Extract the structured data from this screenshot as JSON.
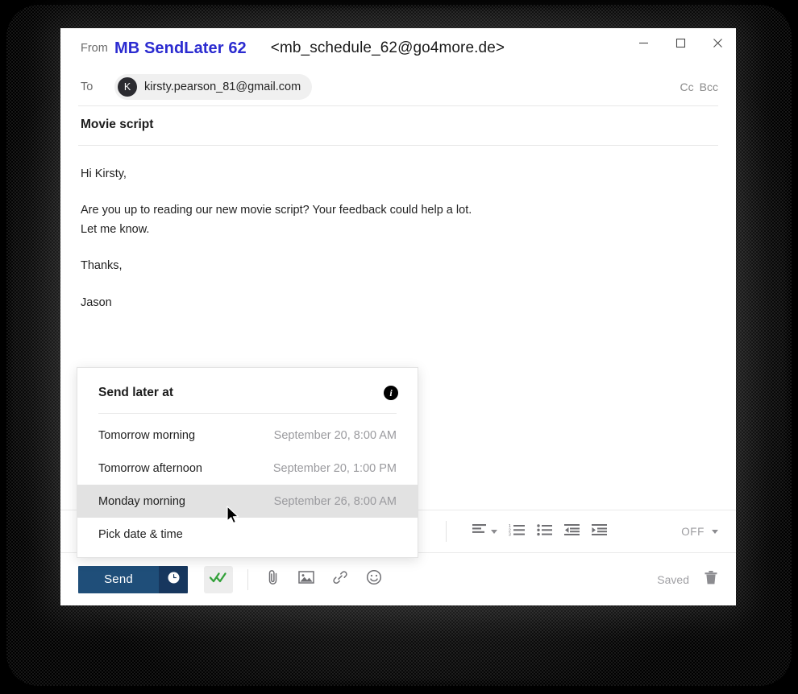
{
  "window": {
    "controls": [
      {
        "name": "minimize",
        "glyph": "—"
      },
      {
        "name": "maximize",
        "glyph": "□"
      },
      {
        "name": "close",
        "glyph": "✕"
      }
    ]
  },
  "compose": {
    "from_label": "From",
    "from_name": "MB SendLater 62",
    "from_address": "<mb_schedule_62@go4more.de>",
    "to_label": "To",
    "recipient_initial": "K",
    "recipient_email": "kirsty.pearson_81@gmail.com",
    "cc_label": "Cc",
    "bcc_label": "Bcc",
    "subject": "Movie script",
    "body": {
      "greeting": "Hi Kirsty,",
      "line1": "Are you up to reading our new movie script? Your feedback could help a lot.",
      "line2": "Let me know.",
      "closing": "Thanks,",
      "signature": "Jason"
    }
  },
  "send_later": {
    "title": "Send later at",
    "info_glyph": "i",
    "options": [
      {
        "label": "Tomorrow morning",
        "datetime": "September 20, 8:00 AM",
        "highlighted": false
      },
      {
        "label": "Tomorrow afternoon",
        "datetime": "September 20, 1:00 PM",
        "highlighted": false
      },
      {
        "label": "Monday morning",
        "datetime": "September 26, 8:00 AM",
        "highlighted": true
      },
      {
        "label": "Pick date & time",
        "datetime": "",
        "highlighted": false
      }
    ]
  },
  "format_toolbar": {
    "align_icon": "align-left-icon",
    "numbered_list_icon": "numbered-list-icon",
    "bullet_list_icon": "bullet-list-icon",
    "outdent_icon": "outdent-icon",
    "indent_icon": "indent-icon",
    "tracking_state": "OFF"
  },
  "bottom_bar": {
    "send_label": "Send",
    "schedule_icon": "clock-icon",
    "read_receipt_icon": "double-check-icon",
    "attach_icon": "paperclip-icon",
    "image_icon": "image-icon",
    "link_icon": "link-icon",
    "emoji_icon": "emoji-icon",
    "saved_label": "Saved",
    "delete_icon": "trash-icon"
  },
  "colors": {
    "send_button": "#1f4e79",
    "send_button_dark": "#17375e",
    "from_name": "#2b2bd0",
    "check_green": "#33a13a",
    "highlight_row": "#e2e2e2"
  }
}
